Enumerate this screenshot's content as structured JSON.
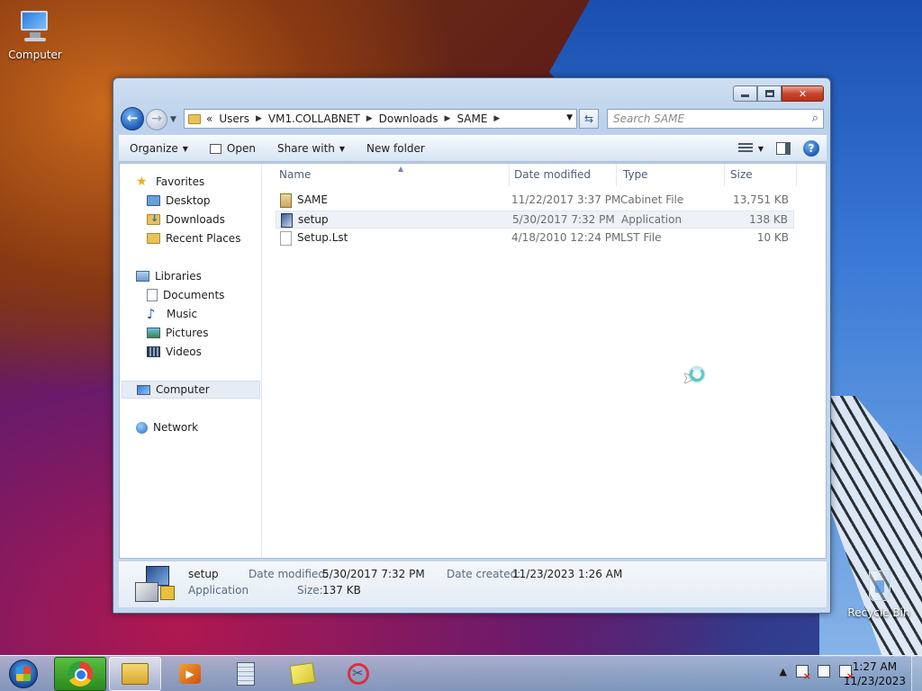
{
  "desktop": {
    "icons": [
      {
        "label": "Computer"
      },
      {
        "label": "Recycle Bin"
      }
    ]
  },
  "window": {
    "address": {
      "overflow": "«",
      "crumbs": [
        "Users",
        "VM1.COLLABNET",
        "Downloads",
        "SAME"
      ]
    },
    "search_placeholder": "Search SAME",
    "toolbar": {
      "organize": "Organize",
      "open": "Open",
      "share_with": "Share with",
      "new_folder": "New folder"
    },
    "nav": {
      "favorites": "Favorites",
      "desktop": "Desktop",
      "downloads": "Downloads",
      "recent_places": "Recent Places",
      "libraries": "Libraries",
      "documents": "Documents",
      "music": "Music",
      "pictures": "Pictures",
      "videos": "Videos",
      "computer": "Computer",
      "network": "Network"
    },
    "columns": {
      "name": "Name",
      "date_modified": "Date modified",
      "type": "Type",
      "size": "Size"
    },
    "files": [
      {
        "name": "SAME",
        "date": "11/22/2017 3:37 PM",
        "type": "Cabinet File",
        "size": "13,751 KB",
        "icon": "cabinet-file-icon"
      },
      {
        "name": "setup",
        "date": "5/30/2017 7:32 PM",
        "type": "Application",
        "size": "138 KB",
        "icon": "application-icon"
      },
      {
        "name": "Setup.Lst",
        "date": "4/18/2010 12:24 PM",
        "type": "LST File",
        "size": "10 KB",
        "icon": "text-file-icon"
      }
    ],
    "details": {
      "name": "setup",
      "type": "Application",
      "date_modified_label": "Date modified:",
      "date_modified": "5/30/2017 7:32 PM",
      "size_label": "Size:",
      "size": "137 KB",
      "date_created_label": "Date created:",
      "date_created": "11/23/2023 1:26 AM"
    }
  },
  "taskbar": {
    "clock_time": "1:27 AM",
    "clock_date": "11/23/2023"
  }
}
